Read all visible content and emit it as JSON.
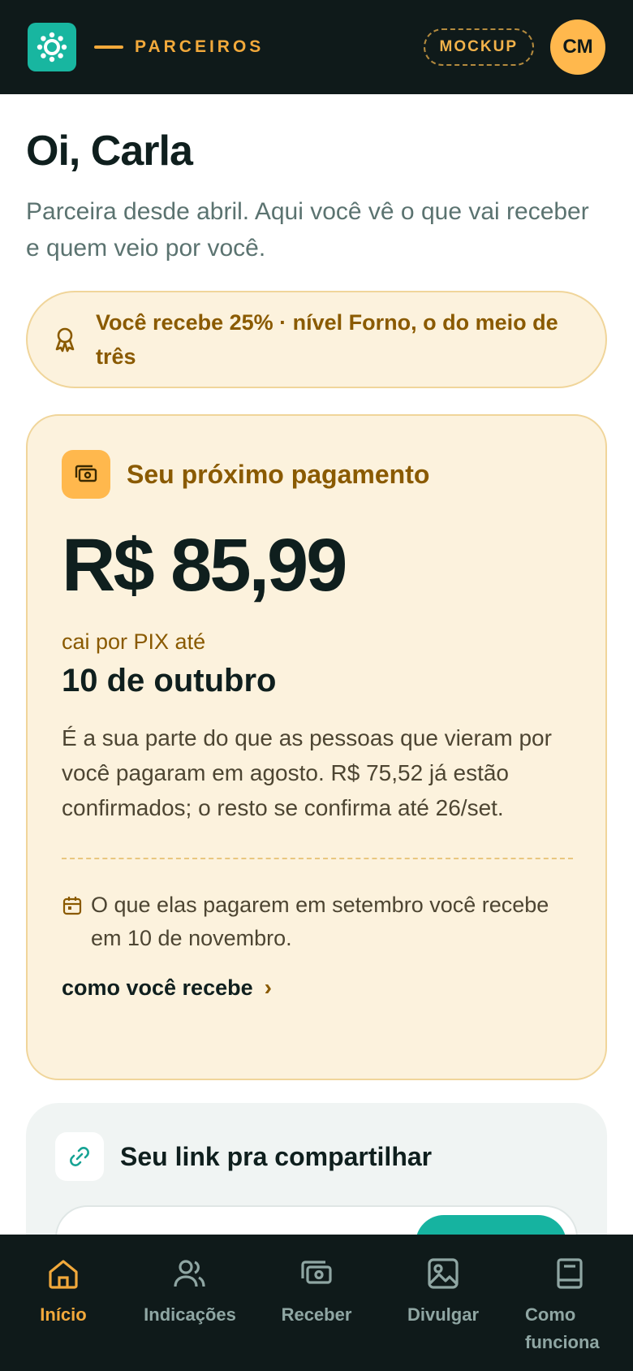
{
  "header": {
    "brand": "PARCEIROS",
    "mock_badge": "MOCKUP",
    "avatar_initials": "CM"
  },
  "greeting": {
    "title": "Oi, Carla",
    "subtitle": "Parceira desde abril. Aqui você vê o que vai receber e quem veio por você."
  },
  "tier": {
    "text": "Você recebe 25% · nível Forno, o do meio de três"
  },
  "payment": {
    "title": "Seu próximo pagamento",
    "amount": "R$ 85,99",
    "due_label": "cai por PIX até",
    "due_date": "10 de outubro",
    "description": "É a sua parte do que as pessoas que vieram por você pagaram em agosto. R$ 75,52 já estão confirmados; o resto se confirma até 26/set.",
    "note": "O que elas pagarem em setembro você recebe em 10 de novembro.",
    "how_link": "como você recebe"
  },
  "share": {
    "title": "Seu link pra compartilhar"
  },
  "nav": {
    "items": [
      {
        "label": "Início",
        "icon": "home-icon"
      },
      {
        "label": "Indicações",
        "icon": "users-icon"
      },
      {
        "label": "Receber",
        "icon": "cash-icon"
      },
      {
        "label": "Divulgar",
        "icon": "image-icon"
      },
      {
        "label": "Como funciona",
        "icon": "book-icon"
      }
    ]
  },
  "colors": {
    "dark": "#0f1a1a",
    "accent": "#f2a93b",
    "teal": "#16b3a0",
    "cream": "#fcf2dd"
  }
}
